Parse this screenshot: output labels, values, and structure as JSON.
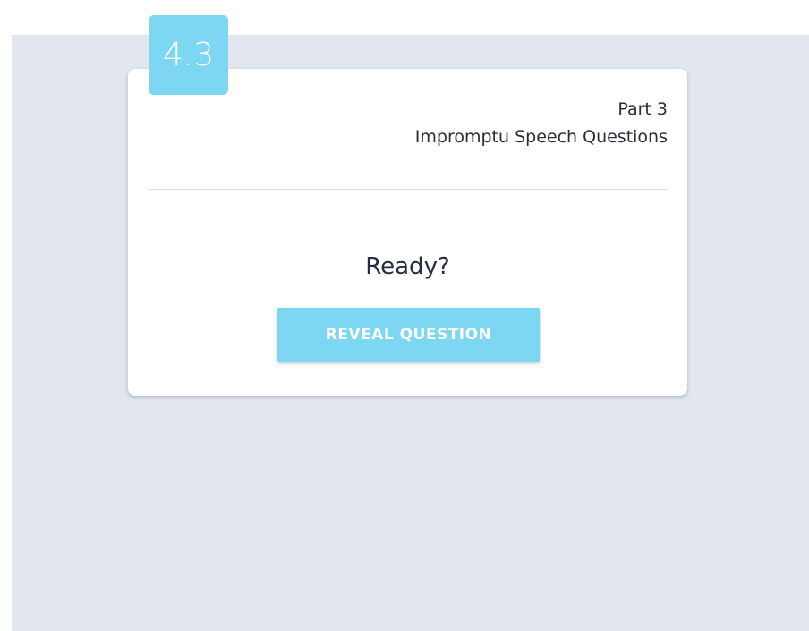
{
  "badge": {
    "label": "4.3"
  },
  "card": {
    "part_label": "Part 3",
    "section_title": "Impromptu Speech Questions",
    "prompt_text": "Ready?",
    "reveal_button_label": "REVEAL QUESTION"
  },
  "colors": {
    "accent": "#7dd6f2",
    "background": "#e2e7ef",
    "card": "#ffffff",
    "text": "#252b40"
  }
}
